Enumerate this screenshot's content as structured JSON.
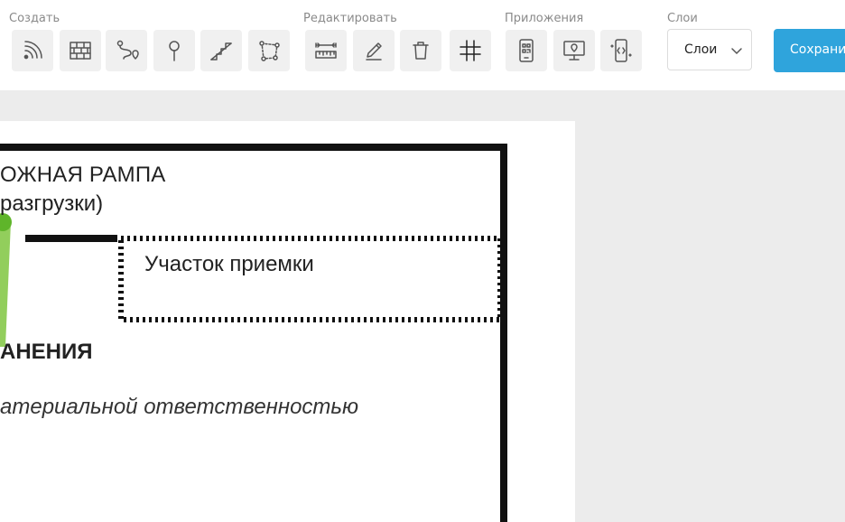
{
  "toolbar": {
    "groups": {
      "create": "Создать",
      "edit": "Редактировать",
      "apps": "Приложения",
      "layers": "Слои"
    },
    "tools": [
      {
        "name": "signal-icon"
      },
      {
        "name": "brick-wall-icon"
      },
      {
        "name": "route-icon"
      },
      {
        "name": "pin-icon"
      },
      {
        "name": "stairs-icon"
      },
      {
        "name": "polygon-icon"
      },
      {
        "name": "ruler-icon"
      },
      {
        "name": "pencil-icon"
      },
      {
        "name": "trash-icon"
      },
      {
        "name": "grid-icon"
      },
      {
        "name": "qr-phone-icon"
      },
      {
        "name": "monitor-pin-icon"
      },
      {
        "name": "phone-code-icon"
      }
    ],
    "layer_select": {
      "value": "Слои"
    },
    "save_label": "Сохранить"
  },
  "floorplan": {
    "ramp_line1": "ОЖНАЯ РАМПА",
    "ramp_line2": "разгрузки)",
    "receiving_zone": "Участок приемки",
    "storage_label": "АНЕНИЯ",
    "responsibility_label": "атериальной ответственностью"
  },
  "colors": {
    "accent": "#2fa4dc",
    "handle": "#6abf2e",
    "wall": "#111111"
  }
}
